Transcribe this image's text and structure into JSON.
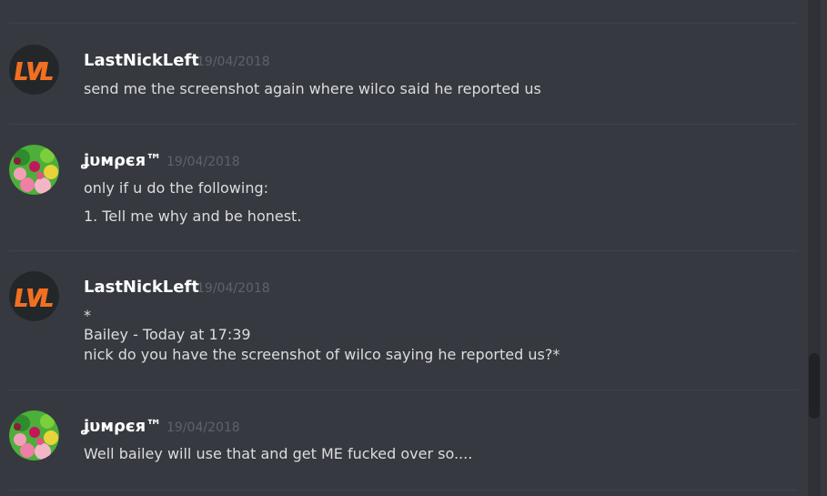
{
  "messages": [
    {
      "username": "LastNickLeft",
      "timestamp": "19/04/2018",
      "lines": [
        "send me the screenshot again where wilco said he reported us"
      ],
      "avatar": "lvl-logo-avatar"
    },
    {
      "username": "ʝυмρєя™",
      "timestamp": "19/04/2018",
      "lines": [
        "only if u do the following:",
        "1. Tell me why and be honest."
      ],
      "avatar": "flower-avatar"
    },
    {
      "username": "LastNickLeft",
      "timestamp": "19/04/2018",
      "lines": [
        "*",
        "Bailey - Today at 17:39",
        "nick do you have the screenshot of wilco saying he reported us?*"
      ],
      "avatar": "lvl-logo-avatar"
    },
    {
      "username": "ʝυмρєя™",
      "timestamp": "19/04/2018",
      "lines": [
        "Well bailey will use that and get ME fucked over so...."
      ],
      "avatar": "flower-avatar"
    }
  ],
  "colors": {
    "background": "#36393f",
    "username": "#ffffff",
    "text": "#dcddde",
    "timestamp": "#5f6269",
    "accent_orange": "#f26f21"
  }
}
